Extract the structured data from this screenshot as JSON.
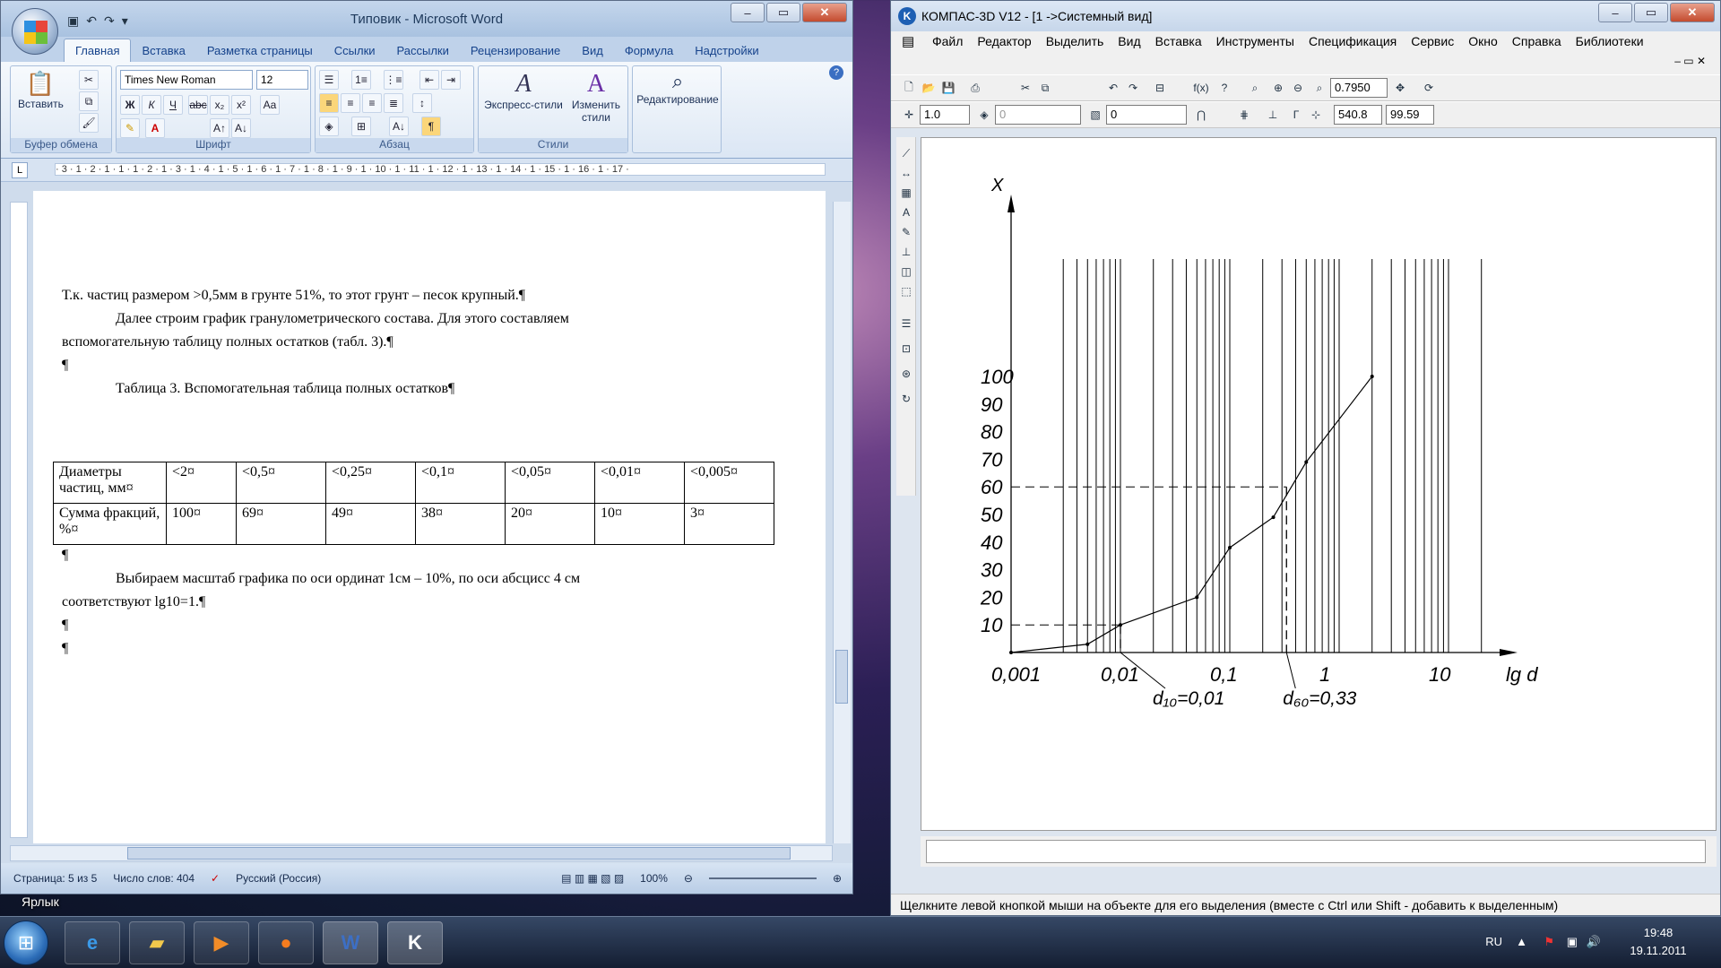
{
  "word": {
    "title": "Типовик - Microsoft Word",
    "tabs": [
      "Главная",
      "Вставка",
      "Разметка страницы",
      "Ссылки",
      "Рассылки",
      "Рецензирование",
      "Вид",
      "Формула",
      "Надстройки"
    ],
    "active_tab": "Главная",
    "ribbon": {
      "clipboard_label": "Буфер обмена",
      "paste_label": "Вставить",
      "font_label": "Шрифт",
      "font_name": "Times New Roman",
      "font_size": "12",
      "paragraph_label": "Абзац",
      "styles_label": "Стили",
      "express_styles": "Экспресс-стили",
      "change_styles": "Изменить стили",
      "editing_label": "Редактирование"
    },
    "ruler_text": "· 3 · 1 · 2 · 1 · 1 · 1 · 2 · 1 · 3 · 1 · 4 · 1 · 5 · 1 · 6 · 1 · 7 · 1 · 8 · 1 · 9 · 1 · 10 · 1 · 11 · 1 · 12 · 1 · 13 · 1 · 14 · 1 · 15 · 1 · 16 · 1 · 17 ·",
    "doc": {
      "p1": "Т.к. частиц размером >0,5мм в грунте 51%, то этот грунт – песок крупный.¶",
      "p2": "Далее строим график гранулометрического состава. Для этого составляем",
      "p3": "вспомогательную таблицу полных остатков (табл. 3).¶",
      "p4": "¶",
      "table_caption": "Таблица 3. Вспомогательная таблица полных остатков¶",
      "table": {
        "row1": [
          "Диаметры частиц, мм¤",
          "<2¤",
          "<0,5¤",
          "<0,25¤",
          "<0,1¤",
          "<0,05¤",
          "<0,01¤",
          "<0,005¤"
        ],
        "row2": [
          "Сумма фракций, %¤",
          "100¤",
          "69¤",
          "49¤",
          "38¤",
          "20¤",
          "10¤",
          "3¤"
        ],
        "cell_mark": "¤"
      },
      "p5": "¶",
      "p6": "Выбираем масштаб графика по оси ординат 1см – 10%, по оси абсцисс 4 см",
      "p7": "соответствуют lg10=1.¶",
      "p8": "¶",
      "p9": "¶"
    },
    "status": {
      "page": "Страница: 5 из 5",
      "words": "Число слов: 404",
      "language": "Русский (Россия)",
      "zoom": "100%"
    }
  },
  "kompas": {
    "title": "КОМПАС-3D V12 - [1 ->Системный вид]",
    "menu": [
      "Файл",
      "Редактор",
      "Выделить",
      "Вид",
      "Вставка",
      "Инструменты",
      "Спецификация",
      "Сервис",
      "Окно",
      "Справка",
      "Библиотеки"
    ],
    "zoom_value": "0.7950",
    "scale_value": "1.0",
    "layer_value": "0",
    "style_value": "0",
    "coord_x": "540.8",
    "coord_y": "99.59",
    "status_hint": "Щелкните левой кнопкой мыши на объекте для его выделения (вместе с Ctrl или Shift - добавить к выделенным)"
  },
  "chart_data": {
    "type": "line",
    "xlabel": "lg d",
    "ylabel": "X",
    "x_scale": "log",
    "x_ticks": [
      "0,001",
      "0,01",
      "0,1",
      "1",
      "10"
    ],
    "y_ticks": [
      "10",
      "20",
      "30",
      "40",
      "50",
      "60",
      "70",
      "80",
      "90",
      "100"
    ],
    "xlim": [
      0.001,
      30
    ],
    "ylim": [
      0,
      100
    ],
    "series": [
      {
        "x": [
          0.001,
          0.005,
          0.01,
          0.05,
          0.1,
          0.25,
          0.5,
          2
        ],
        "y": [
          0,
          3,
          10,
          20,
          38,
          49,
          69,
          100
        ]
      }
    ],
    "annotations": [
      {
        "label": "d₁₀=0,01",
        "x": 0.01,
        "y": 10
      },
      {
        "label": "d₆₀=0,33",
        "x": 0.33,
        "y": 60
      }
    ],
    "grid": "log-vertical"
  },
  "desktop": {
    "shortcut_label": "Ярлык"
  },
  "taskbar": {
    "lang": "RU",
    "time": "19:48",
    "date": "19.11.2011"
  }
}
